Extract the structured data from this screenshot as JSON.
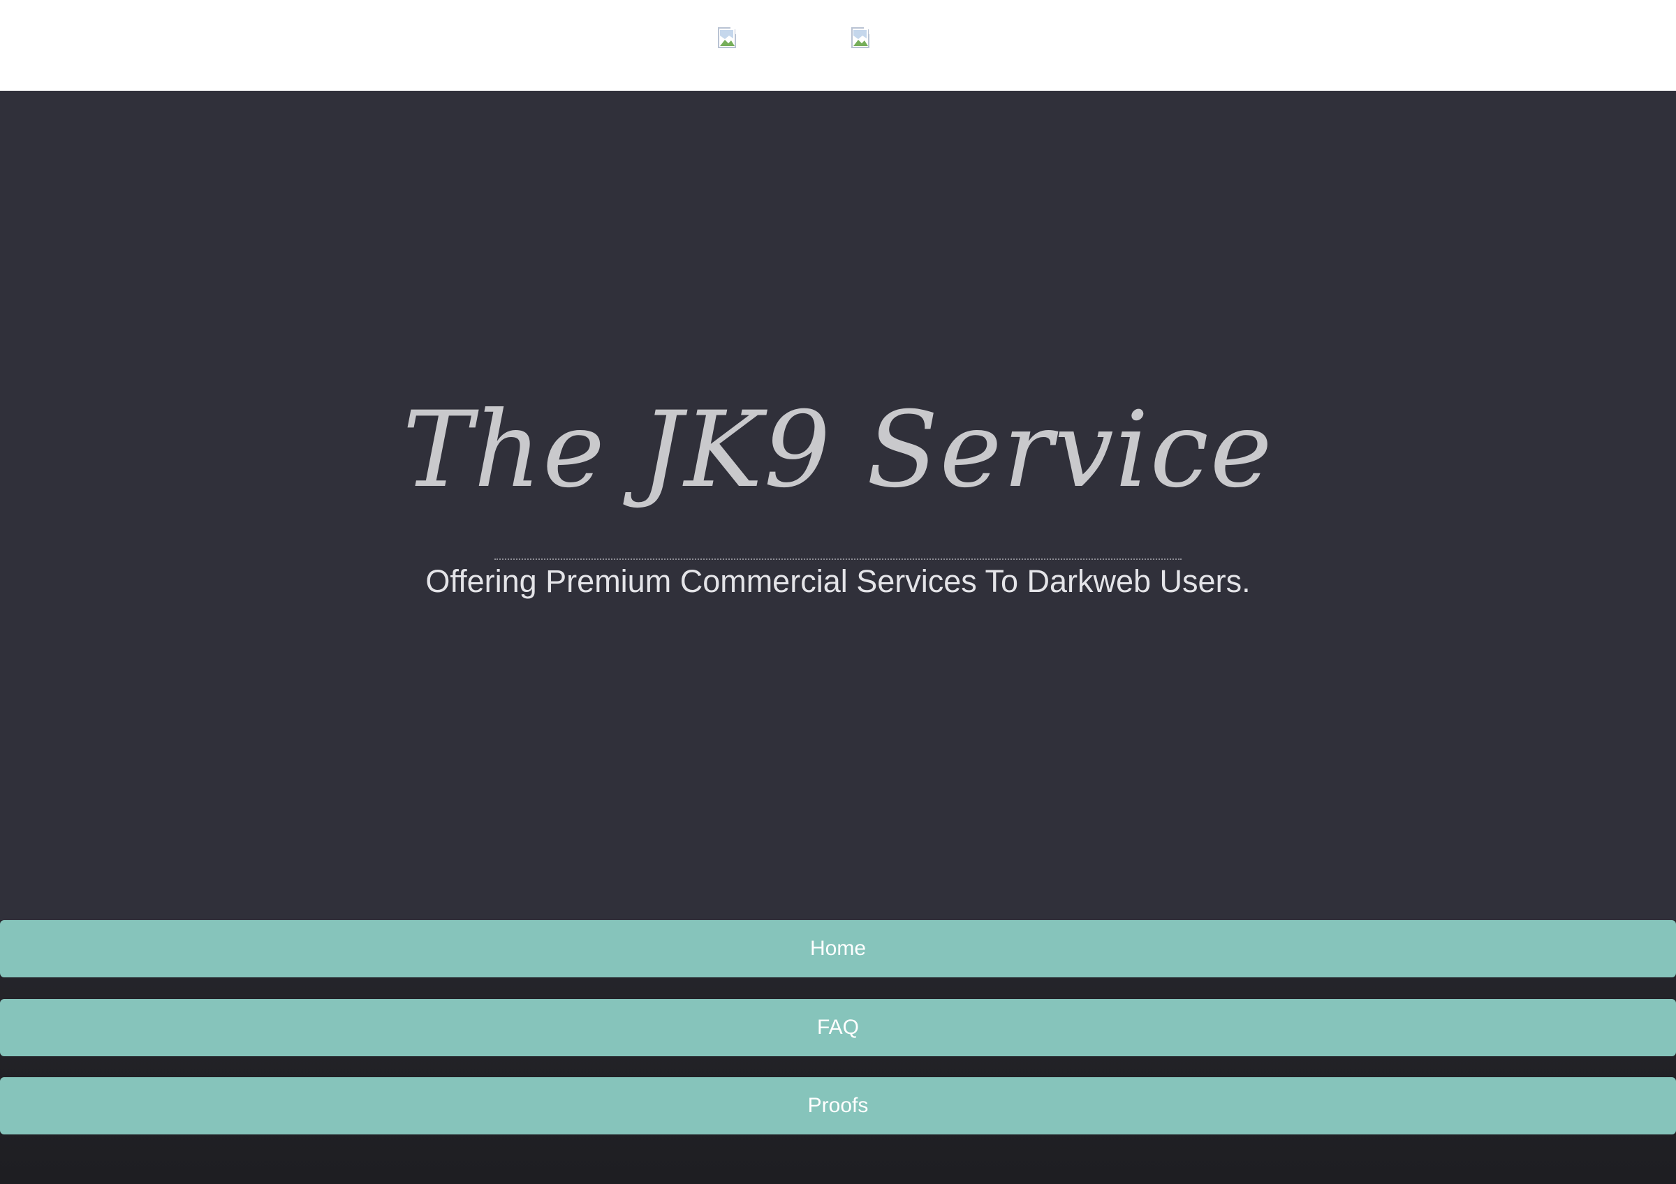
{
  "header": {
    "images": [
      {
        "icon": "broken-image-icon"
      },
      {
        "icon": "broken-image-icon"
      }
    ]
  },
  "hero": {
    "title": "The JK9 Service",
    "subtitle": "Offering Premium Commercial Services To Darkweb Users."
  },
  "nav": {
    "items": [
      {
        "label": "Home"
      },
      {
        "label": "FAQ"
      },
      {
        "label": "Proofs"
      }
    ]
  },
  "colors": {
    "topbar": "#ffffff",
    "hero_bg": "#30303a",
    "footer_bg": "#1f1f23",
    "button_bg": "#86c4bb",
    "button_text": "#ffffff",
    "title_text": "#c9c9cc"
  }
}
